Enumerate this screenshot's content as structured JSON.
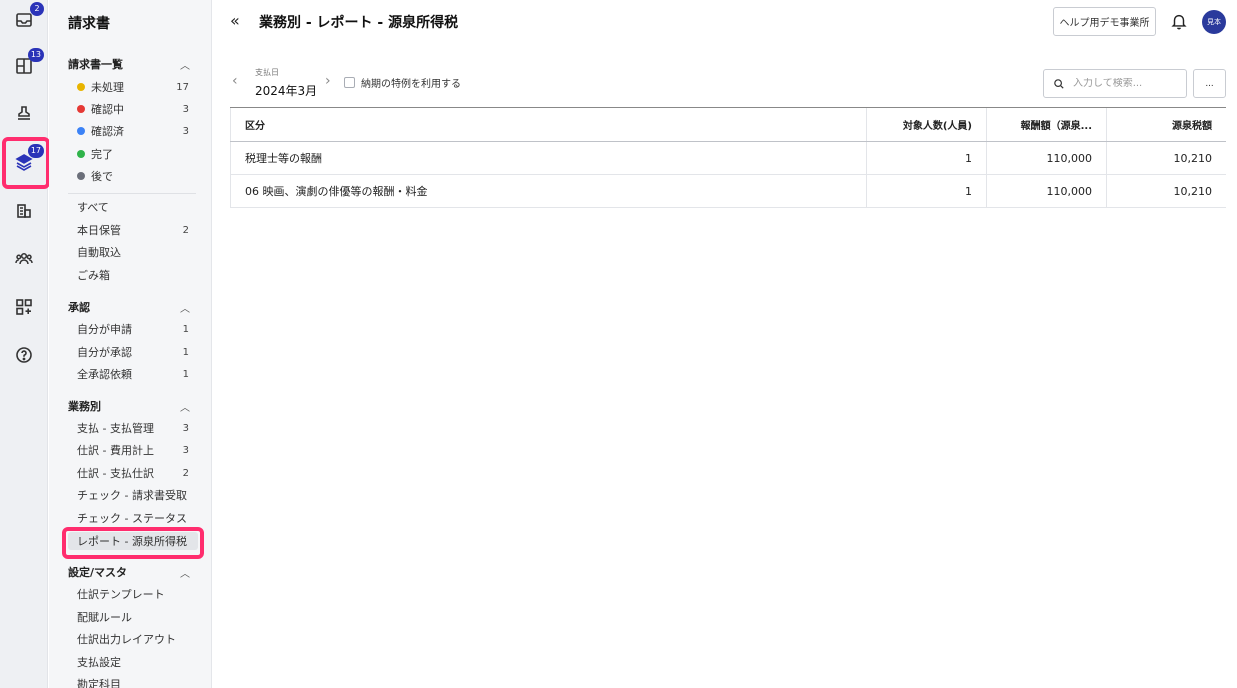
{
  "rail": {
    "items": [
      {
        "icon": "inbox-icon",
        "badge": "2"
      },
      {
        "icon": "grid-plus-icon",
        "badge": "13"
      },
      {
        "icon": "stamp-icon",
        "badge": ""
      },
      {
        "icon": "layers-icon",
        "badge": "17"
      },
      {
        "icon": "building-icon",
        "badge": ""
      },
      {
        "icon": "people-icon",
        "badge": ""
      },
      {
        "icon": "apps-add-icon",
        "badge": ""
      },
      {
        "icon": "help-circle-icon",
        "badge": ""
      }
    ]
  },
  "sidebar": {
    "title": "請求書",
    "invoice_list": {
      "heading": "請求書一覧",
      "status_items": [
        {
          "label": "未処理",
          "count": "17",
          "color": "#e8b400"
        },
        {
          "label": "確認中",
          "count": "3",
          "color": "#e53935"
        },
        {
          "label": "確認済",
          "count": "3",
          "color": "#3b82f6"
        },
        {
          "label": "完了",
          "count": "",
          "color": "#2fb34a"
        },
        {
          "label": "後で",
          "count": "",
          "color": "#6b6f7a"
        }
      ],
      "other_items": [
        {
          "label": "すべて",
          "count": ""
        },
        {
          "label": "本日保管",
          "count": "2"
        },
        {
          "label": "自動取込",
          "count": ""
        },
        {
          "label": "ごみ箱",
          "count": ""
        }
      ]
    },
    "approval": {
      "heading": "承認",
      "items": [
        {
          "label": "自分が申請",
          "count": "1"
        },
        {
          "label": "自分が承認",
          "count": "1"
        },
        {
          "label": "全承認依頼",
          "count": "1"
        }
      ]
    },
    "by_task": {
      "heading": "業務別",
      "items": [
        {
          "label": "支払 - 支払管理",
          "count": "3"
        },
        {
          "label": "仕訳 - 費用計上",
          "count": "3"
        },
        {
          "label": "仕訳 - 支払仕訳",
          "count": "2"
        },
        {
          "label": "チェック - 請求書受取",
          "count": ""
        },
        {
          "label": "チェック - ステータス",
          "count": ""
        },
        {
          "label": "レポート - 源泉所得税",
          "count": ""
        }
      ]
    },
    "settings": {
      "heading": "設定/マスタ",
      "items": [
        {
          "label": "仕訳テンプレート"
        },
        {
          "label": "配賦ルール"
        },
        {
          "label": "仕訳出力レイアウト"
        },
        {
          "label": "支払設定"
        },
        {
          "label": "勘定科目"
        }
      ]
    }
  },
  "header": {
    "title": "業務別 - レポート - 源泉所得税",
    "help_button": "ヘルプ用デモ事業所",
    "avatar": "見本"
  },
  "filters": {
    "date_label": "支払日",
    "date_value": "2024年3月",
    "checkbox_label": "納期の特例を利用する",
    "search_placeholder": "入力して検索...",
    "more_label": "..."
  },
  "table": {
    "columns": [
      "区分",
      "対象人数(人員)",
      "報酬額（源泉...",
      "源泉税額"
    ],
    "rows": [
      [
        "税理士等の報酬",
        "1",
        "110,000",
        "10,210"
      ],
      [
        "06 映画、演劇の俳優等の報酬・料金",
        "1",
        "110,000",
        "10,210"
      ]
    ]
  }
}
